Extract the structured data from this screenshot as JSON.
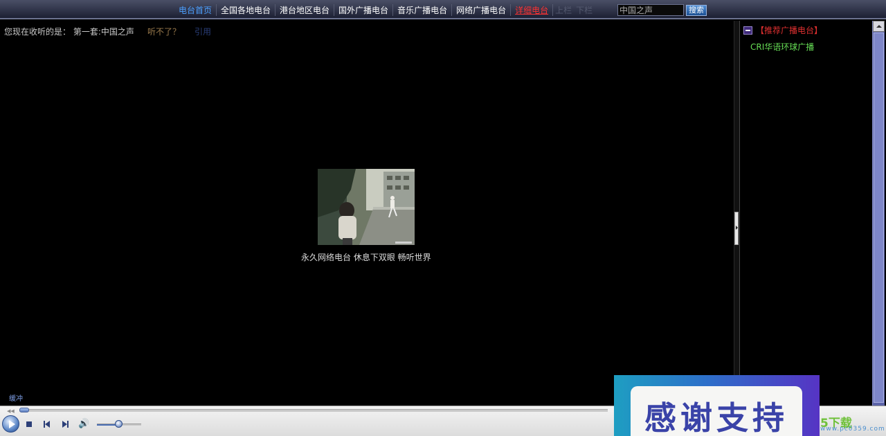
{
  "nav": {
    "links": [
      {
        "label": "电台首页"
      },
      {
        "label": "全国各地电台"
      },
      {
        "label": "港台地区电台"
      },
      {
        "label": "国外广播电台"
      },
      {
        "label": "音乐广播电台"
      },
      {
        "label": "网络广播电台"
      },
      {
        "label": "详细电台"
      }
    ],
    "prev_label": "上栏",
    "next_label": "下栏",
    "search_value": "中国之声",
    "search_button": "搜索"
  },
  "now_playing": {
    "text": "您现在收听的是： 第一套:中国之声",
    "cant_hear": "听不了？",
    "quote": "引用"
  },
  "main": {
    "caption": "永久网络电台 休息下双眼 畅听世界"
  },
  "sidebar": {
    "title": "【推荐广播电台】",
    "items": [
      {
        "label": "CRI华语环球广播"
      }
    ]
  },
  "player": {
    "buffer_label": "缓冲",
    "volume_level": 0.5,
    "progress": 0.01
  },
  "ad": {
    "text": "感谢支持"
  },
  "watermark": {
    "logo": "5下载",
    "url": "www.pc0359.com"
  },
  "colors": {
    "nav_active": "#4ca0ff",
    "nav_hot": "#ff3333",
    "sidebar_title": "#e03030",
    "sidebar_item": "#66dd55"
  }
}
